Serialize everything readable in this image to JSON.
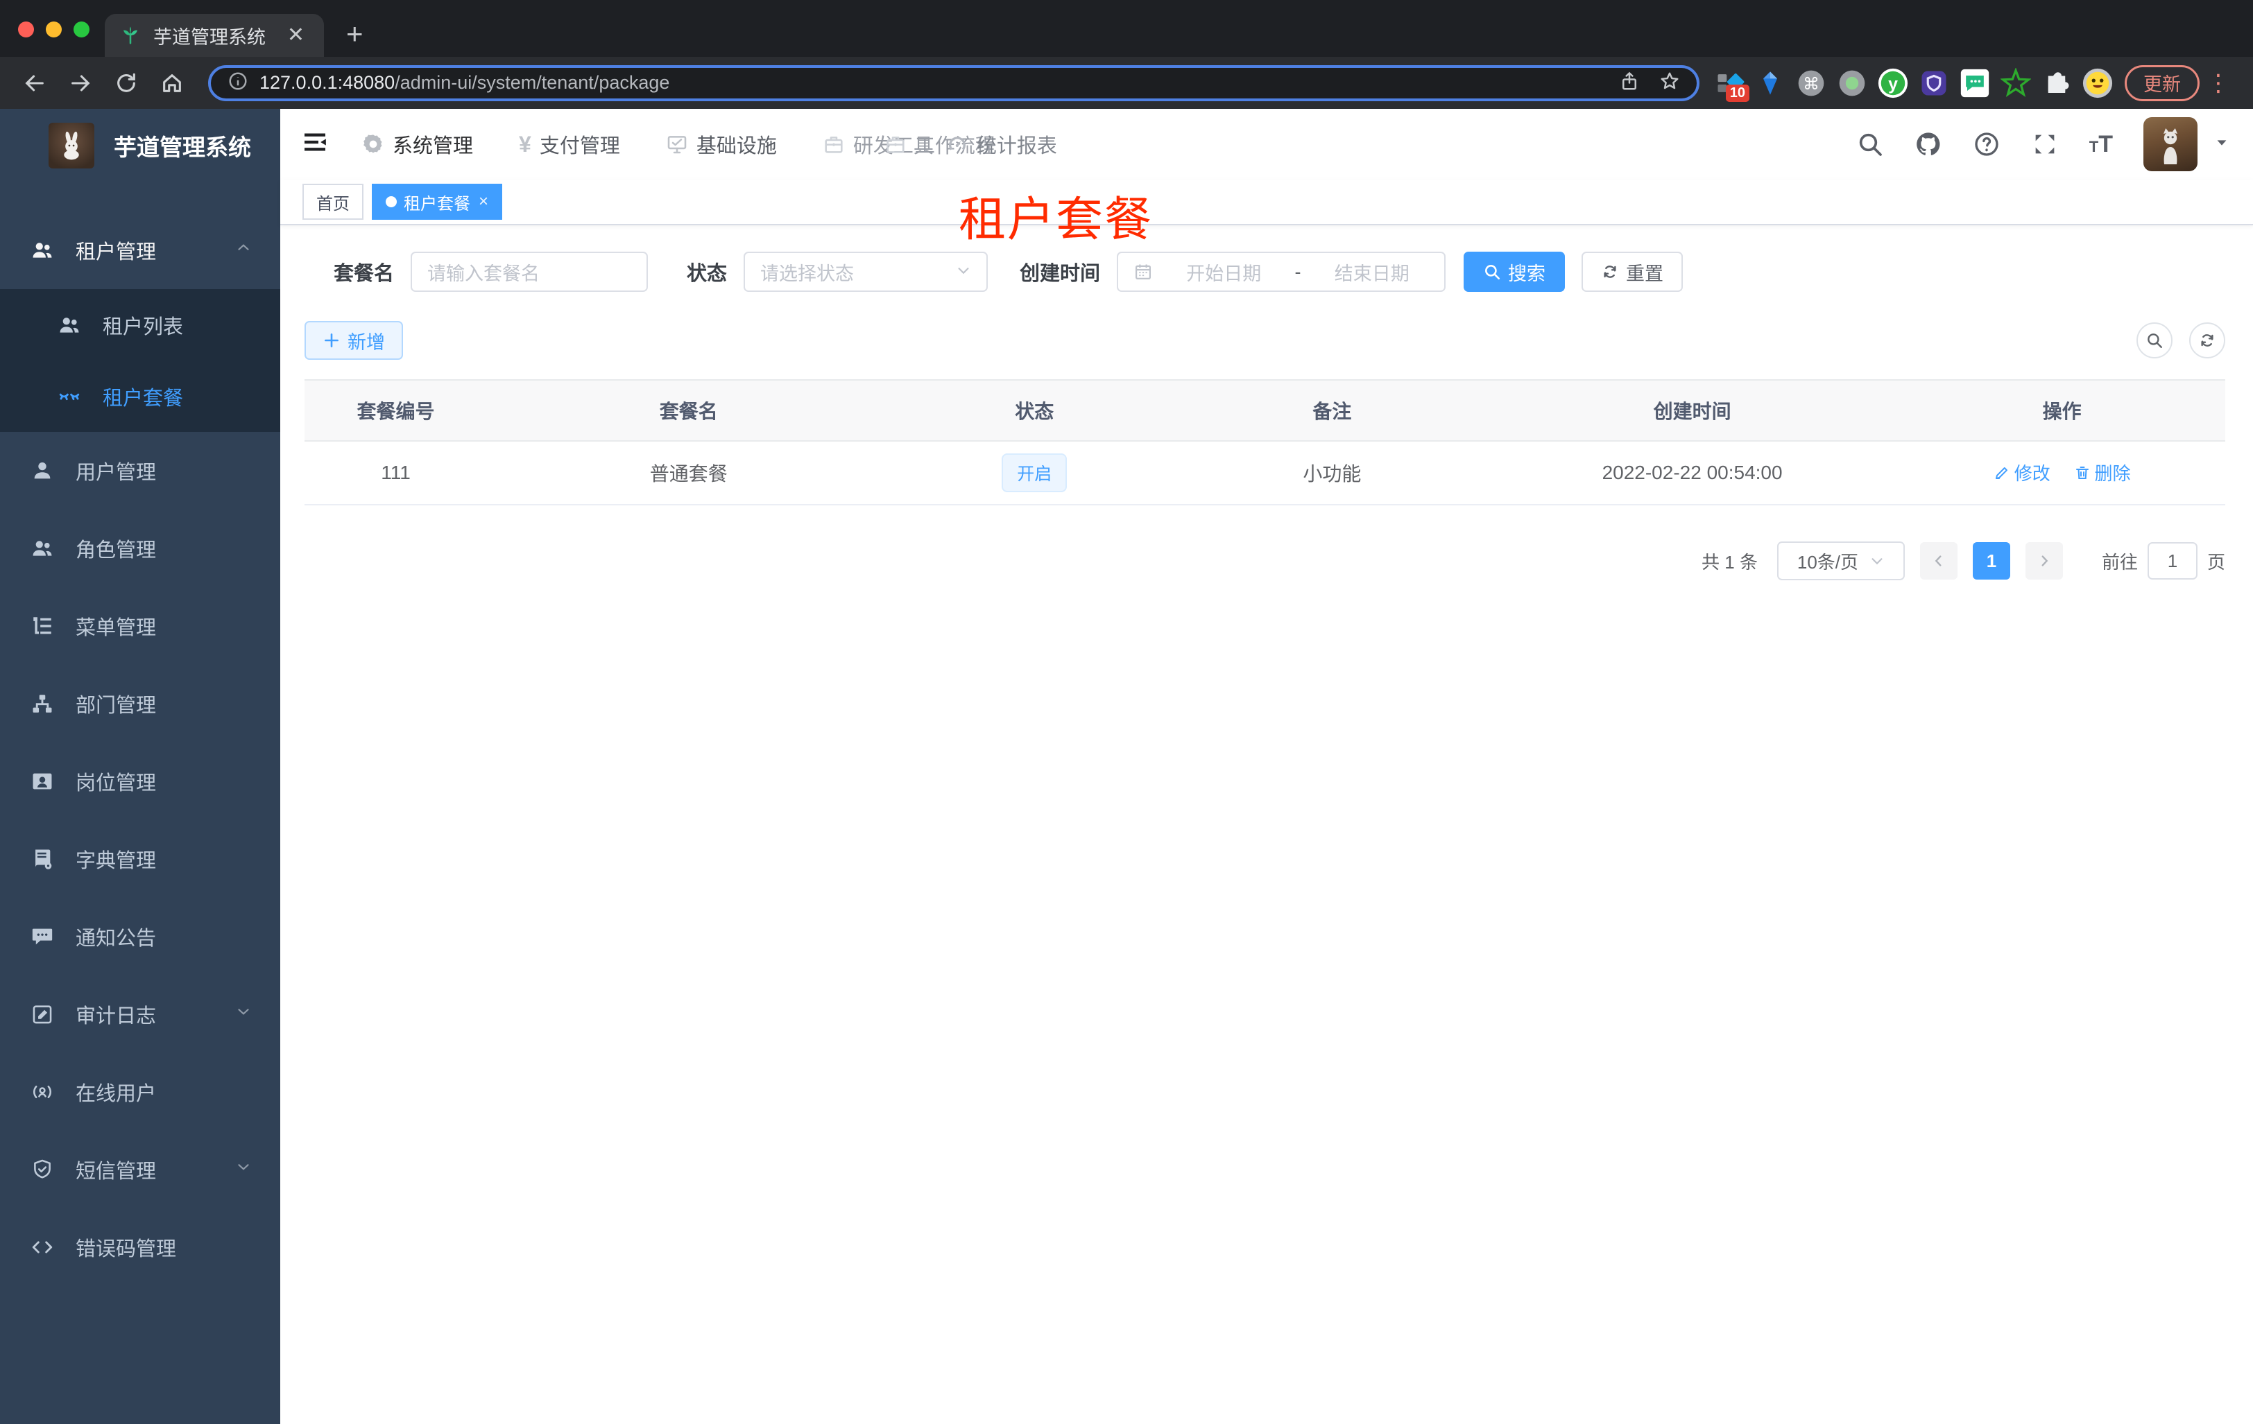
{
  "browser": {
    "tab": {
      "title": "芋道管理系统"
    },
    "url": {
      "host": "127.0.0.1:48080",
      "path": "/admin-ui/system/tenant/package"
    },
    "ext_badge": "10",
    "update_label": "更新"
  },
  "app": {
    "logo_title": "芋道管理系统"
  },
  "nav": {
    "items": [
      {
        "label": "系统管理"
      },
      {
        "label": "支付管理"
      },
      {
        "label": "基础设施"
      },
      {
        "label": "研发工具"
      },
      {
        "label": "工作流程"
      },
      {
        "label": "统计报表"
      }
    ]
  },
  "sidebar": {
    "items": [
      {
        "label": "租户管理"
      },
      {
        "label": "租户列表"
      },
      {
        "label": "租户套餐"
      },
      {
        "label": "用户管理"
      },
      {
        "label": "角色管理"
      },
      {
        "label": "菜单管理"
      },
      {
        "label": "部门管理"
      },
      {
        "label": "岗位管理"
      },
      {
        "label": "字典管理"
      },
      {
        "label": "通知公告"
      },
      {
        "label": "审计日志"
      },
      {
        "label": "在线用户"
      },
      {
        "label": "短信管理"
      },
      {
        "label": "错误码管理"
      }
    ]
  },
  "tags": {
    "items": [
      {
        "label": "首页"
      },
      {
        "label": "租户套餐"
      }
    ]
  },
  "overlay": {
    "title": "租户套餐"
  },
  "filters": {
    "name": {
      "label": "套餐名",
      "placeholder": "请输入套餐名"
    },
    "status": {
      "label": "状态",
      "placeholder": "请选择状态"
    },
    "date": {
      "label": "创建时间",
      "start": "开始日期",
      "sep": "-",
      "end": "结束日期"
    },
    "search": "搜索",
    "reset": "重置"
  },
  "actions": {
    "add": "新增"
  },
  "table": {
    "headers": [
      "套餐编号",
      "套餐名",
      "状态",
      "备注",
      "创建时间",
      "操作"
    ],
    "rows": [
      {
        "id": "111",
        "name": "普通套餐",
        "status": "开启",
        "remark": "小功能",
        "created": "2022-02-22 00:54:00",
        "edit": "修改",
        "delete": "删除"
      }
    ]
  },
  "pager": {
    "total": "共 1 条",
    "size": "10条/页",
    "page": "1",
    "goto_prefix": "前往",
    "goto_value": "1",
    "goto_suffix": "页"
  },
  "colors": {
    "accent": "#409eff",
    "sidebar_bg": "#304156",
    "submenu_bg": "#1f2d3d",
    "overlay_red": "#ff2b00"
  }
}
